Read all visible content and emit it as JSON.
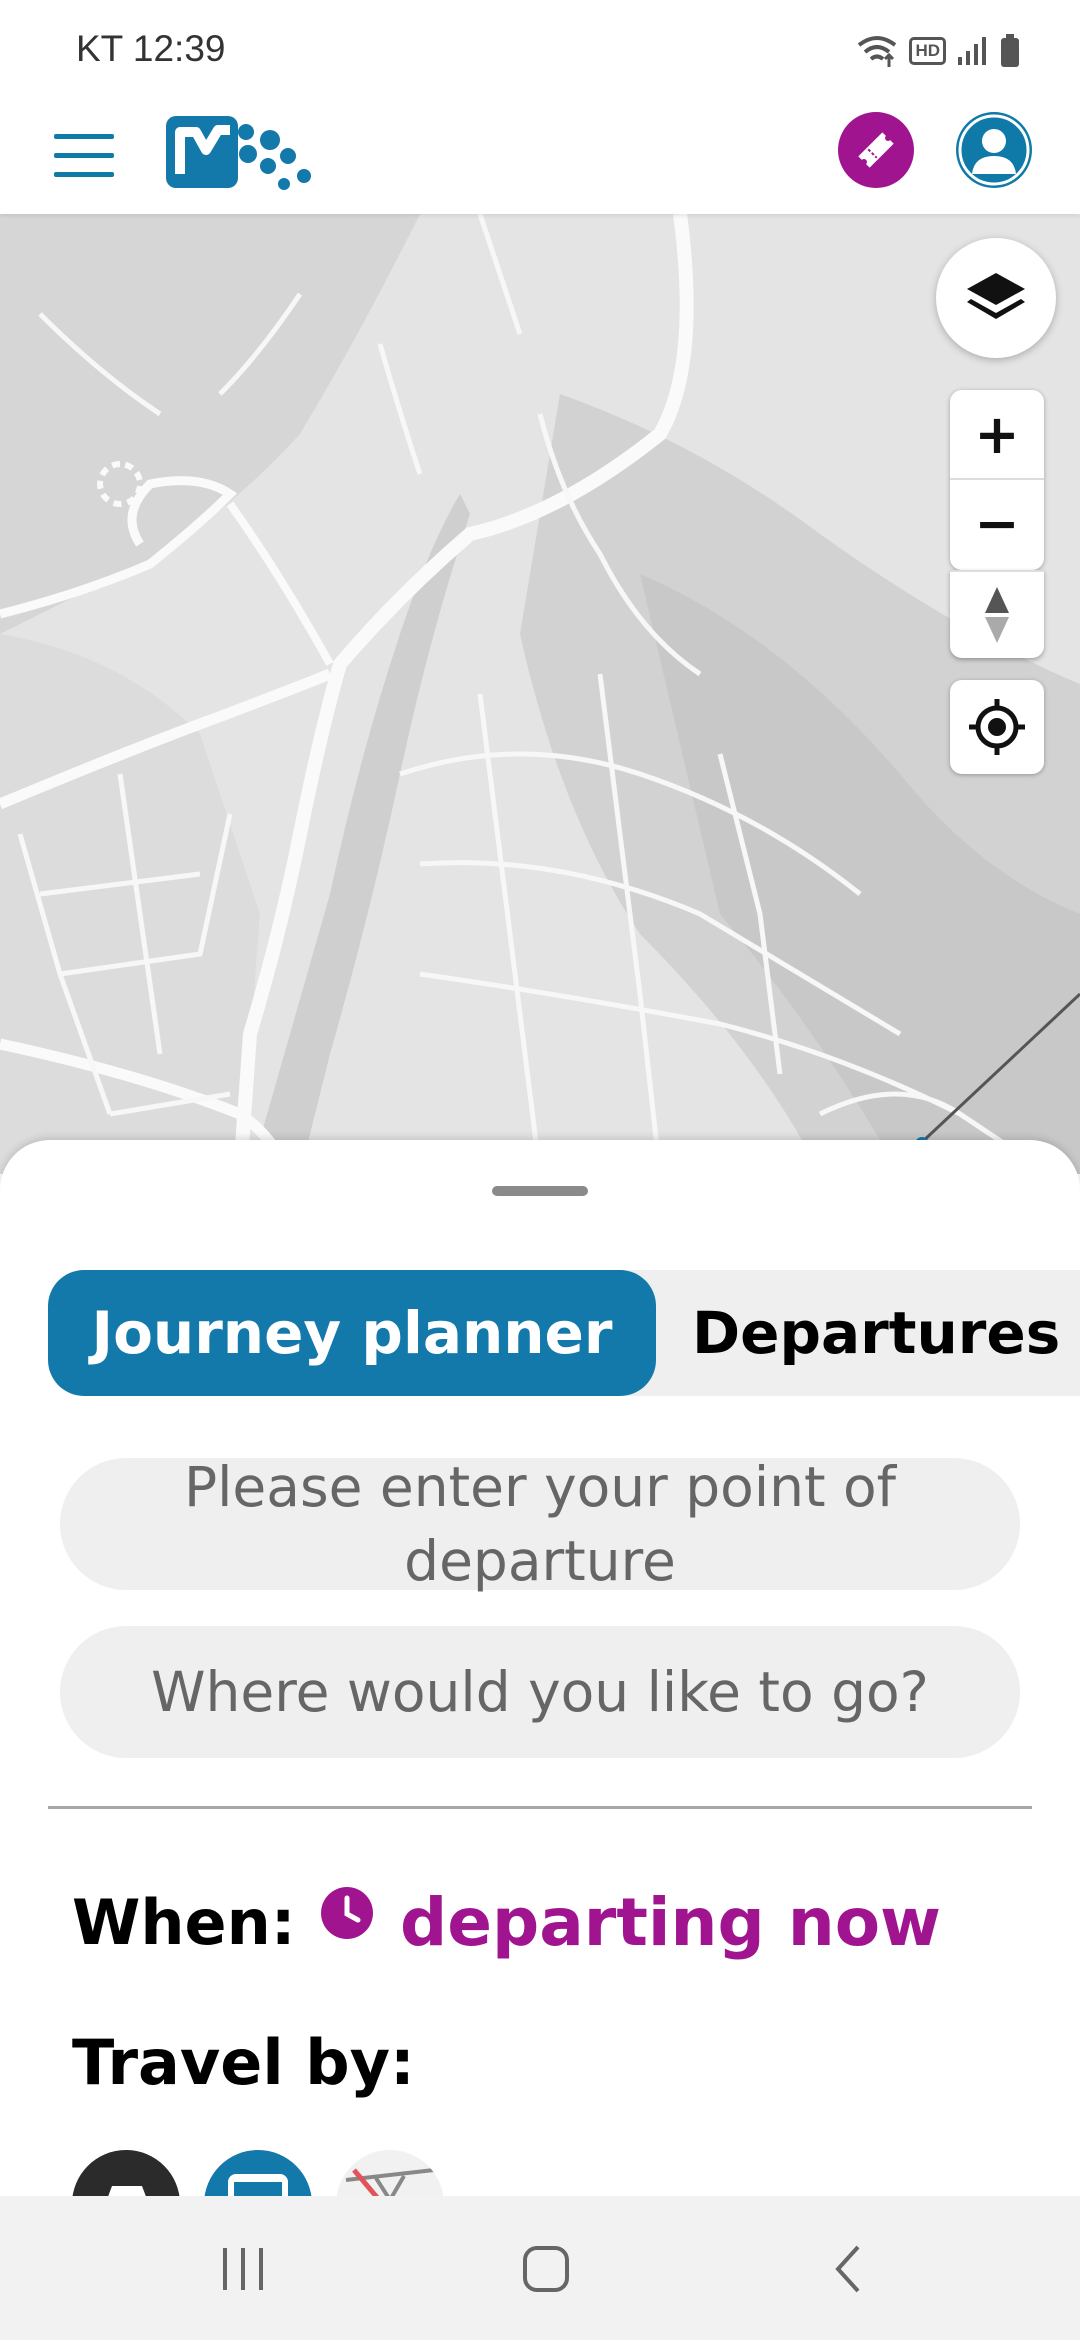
{
  "status_bar": {
    "carrier": "KT",
    "time": "12:39",
    "hd_badge": "HD"
  },
  "header": {
    "menu_icon": "hamburger-menu-icon",
    "logo": "mobility-logo",
    "ticket_icon": "ticket-icon",
    "account_icon": "account-icon",
    "brand_color": "#1379ab",
    "accent_color": "#a0158f"
  },
  "map_controls": {
    "layers_icon": "layers-icon",
    "zoom_in": "+",
    "zoom_out": "−",
    "compass_icon": "compass-icon",
    "locate_icon": "my-location-icon"
  },
  "sheet": {
    "tabs": [
      {
        "label": "Journey planner",
        "active": true
      },
      {
        "label": "Departures",
        "active": false
      }
    ],
    "from_placeholder": "Please enter your point of departure",
    "to_placeholder": "Where would you like to go?",
    "when_label": "When:",
    "when_value": "departing now",
    "travel_label": "Travel by:",
    "modes": [
      "ferry-icon",
      "bus-icon",
      "cable-car-icon"
    ]
  },
  "nav_bar": {
    "items": [
      "recent-apps-icon",
      "home-icon",
      "back-icon"
    ]
  }
}
